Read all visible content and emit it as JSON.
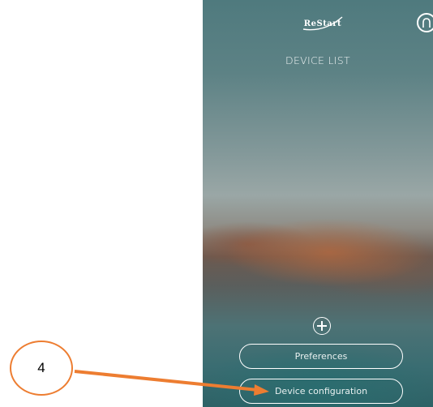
{
  "app": {
    "logo_text": "ReStart",
    "title": "DEVICE LIST"
  },
  "buttons": {
    "preferences_label": "Preferences",
    "device_config_label": "Device configuration"
  },
  "icons": {
    "user": "user-account-icon",
    "add": "add-device-icon"
  },
  "annotation": {
    "number": "4",
    "color": "#ed7d31"
  }
}
